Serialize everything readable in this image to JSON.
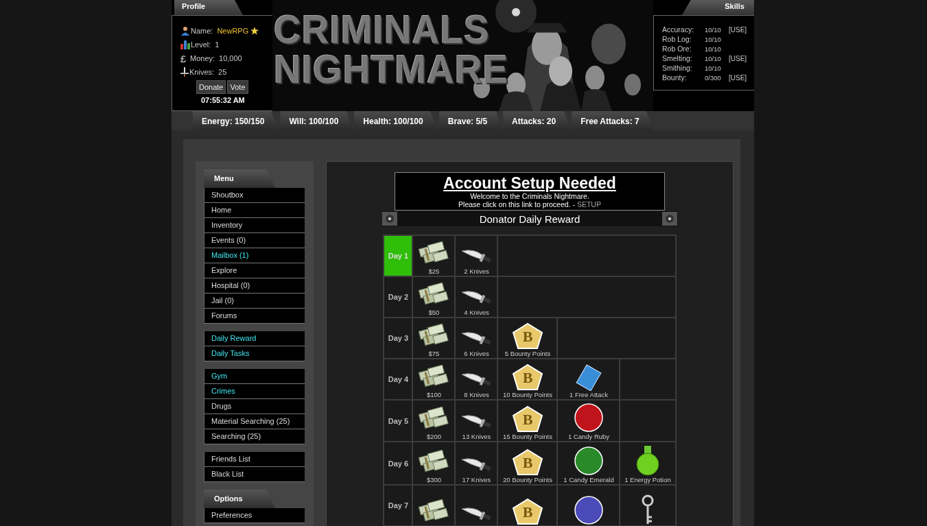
{
  "profile": {
    "tab": "Profile",
    "fields": [
      {
        "kind": "name",
        "label": "Name:",
        "value": "NewRPG",
        "starred": true
      },
      {
        "kind": "level",
        "label": "Level:",
        "value": "1"
      },
      {
        "kind": "money",
        "label": "Money:",
        "value": "10,000",
        "currency": "£"
      },
      {
        "kind": "knives",
        "label": "Knives:",
        "value": "25"
      }
    ],
    "buttons": [
      "Donate",
      "Vote"
    ],
    "time": "07:55:32 AM"
  },
  "logo": [
    "CRIMINALS",
    "NIGHTMARE"
  ],
  "skills": {
    "tab": "Skills",
    "rows": [
      {
        "name": "Accuracy:",
        "value": "10/10",
        "action": "[USE]"
      },
      {
        "name": "Rob Log:",
        "value": "10/10"
      },
      {
        "name": "Rob Ore:",
        "value": "10/10"
      },
      {
        "name": "Smelting:",
        "value": "10/10",
        "action": "[USE]"
      },
      {
        "name": "Smithing:",
        "value": "10/10"
      },
      {
        "name": "Bounty:",
        "value": "0/300",
        "action": "[USE]"
      }
    ]
  },
  "stats": [
    "Energy: 150/150",
    "Will: 100/100",
    "Health: 100/100",
    "Brave: 5/5",
    "Attacks: 20",
    "Free Attacks: 7"
  ],
  "menu": {
    "title": "Menu",
    "groups": [
      [
        {
          "label": "Shoutbox",
          "highlight": false
        },
        {
          "label": "Home",
          "highlight": false
        },
        {
          "label": "Inventory",
          "highlight": false
        },
        {
          "label": "Events (0)",
          "highlight": false
        },
        {
          "label": "Mailbox (1)",
          "highlight": true
        },
        {
          "label": "Explore",
          "highlight": false
        },
        {
          "label": "Hospital (0)",
          "highlight": false
        },
        {
          "label": "Jail (0)",
          "highlight": false
        },
        {
          "label": "Forums",
          "highlight": false
        }
      ],
      [
        {
          "label": "Daily Reward",
          "highlight": true
        },
        {
          "label": "Daily Tasks",
          "highlight": true
        }
      ],
      [
        {
          "label": "Gym",
          "highlight": true
        },
        {
          "label": "Crimes",
          "highlight": true
        },
        {
          "label": "Drugs",
          "highlight": false
        },
        {
          "label": "Material Searching (25)",
          "highlight": false
        },
        {
          "label": "Searching (25)",
          "highlight": false
        }
      ],
      [
        {
          "label": "Friends List",
          "highlight": false
        },
        {
          "label": "Black List",
          "highlight": false
        }
      ]
    ]
  },
  "options": {
    "title": "Options",
    "items": [
      {
        "label": "Preferences",
        "highlight": false
      }
    ]
  },
  "notice": {
    "title": "Account Setup Needed",
    "line1": "Welcome to the Criminals Nightmare.",
    "line2": "Please click on this link to proceed. -",
    "link": "SETUP"
  },
  "reward": {
    "title": "Donator Daily Reward",
    "days": [
      {
        "label": "Day 1",
        "selected": true,
        "items": [
          {
            "kind": "cash",
            "label": "$25"
          },
          {
            "kind": "knife",
            "label": "2 Knives"
          }
        ]
      },
      {
        "label": "Day 2",
        "selected": false,
        "items": [
          {
            "kind": "cash",
            "label": "$50"
          },
          {
            "kind": "knife",
            "label": "4 Knives"
          }
        ]
      },
      {
        "label": "Day 3",
        "selected": false,
        "items": [
          {
            "kind": "cash",
            "label": "$75"
          },
          {
            "kind": "knife",
            "label": "6 Knives"
          },
          {
            "kind": "bounty",
            "label": "5 Bounty Points",
            "mark": "B"
          }
        ]
      },
      {
        "label": "Day 4",
        "selected": false,
        "items": [
          {
            "kind": "cash",
            "label": "$100"
          },
          {
            "kind": "knife",
            "label": "8 Knives"
          },
          {
            "kind": "bounty",
            "label": "10 Bounty Points",
            "mark": "B"
          },
          {
            "kind": "ticket",
            "label": "1 Free Attack"
          }
        ]
      },
      {
        "label": "Day 5",
        "selected": false,
        "items": [
          {
            "kind": "cash",
            "label": "$200"
          },
          {
            "kind": "knife",
            "label": "13 Knives"
          },
          {
            "kind": "bounty",
            "label": "15 Bounty Points",
            "mark": "B"
          },
          {
            "kind": "gem",
            "color": "#c0141c",
            "label": "1 Candy Ruby"
          }
        ]
      },
      {
        "label": "Day 6",
        "selected": false,
        "items": [
          {
            "kind": "cash",
            "label": "$300"
          },
          {
            "kind": "knife",
            "label": "17 Knives"
          },
          {
            "kind": "bounty",
            "label": "20 Bounty Points",
            "mark": "B"
          },
          {
            "kind": "gem",
            "color": "#2a8a2a",
            "label": "1 Candy Emerald"
          },
          {
            "kind": "potion",
            "label": "1 Energy Potion"
          }
        ]
      },
      {
        "label": "Day 7",
        "selected": false,
        "items": [
          {
            "kind": "cash"
          },
          {
            "kind": "knife"
          },
          {
            "kind": "bounty",
            "mark": "B"
          },
          {
            "kind": "gem",
            "color": "#4a4ab8"
          },
          {
            "kind": "key"
          }
        ]
      }
    ]
  }
}
